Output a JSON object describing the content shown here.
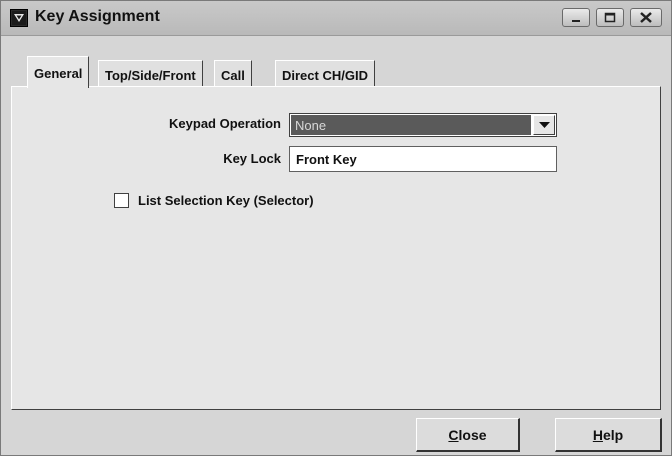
{
  "window": {
    "title": "Key Assignment"
  },
  "tabs": [
    {
      "label": "General",
      "active": true
    },
    {
      "label": "Top/Side/Front",
      "active": false
    },
    {
      "label": "Call",
      "active": false
    },
    {
      "label": "Direct CH/GID",
      "active": false
    }
  ],
  "general": {
    "keypad_operation": {
      "label": "Keypad Operation",
      "value": "None"
    },
    "key_lock": {
      "label": "Key Lock",
      "value": "Front Key"
    },
    "list_selection": {
      "label": "List Selection Key (Selector)",
      "checked": false
    }
  },
  "buttons": {
    "close": {
      "mnemonic": "C",
      "rest": "lose"
    },
    "help": {
      "mnemonic": "H",
      "rest": "elp"
    }
  },
  "icons": {
    "app": "key-assignment-app-icon",
    "minimize": "minimize-icon",
    "maximize": "maximize-icon",
    "close": "close-window-icon",
    "dropdown": "chevron-down-icon"
  }
}
